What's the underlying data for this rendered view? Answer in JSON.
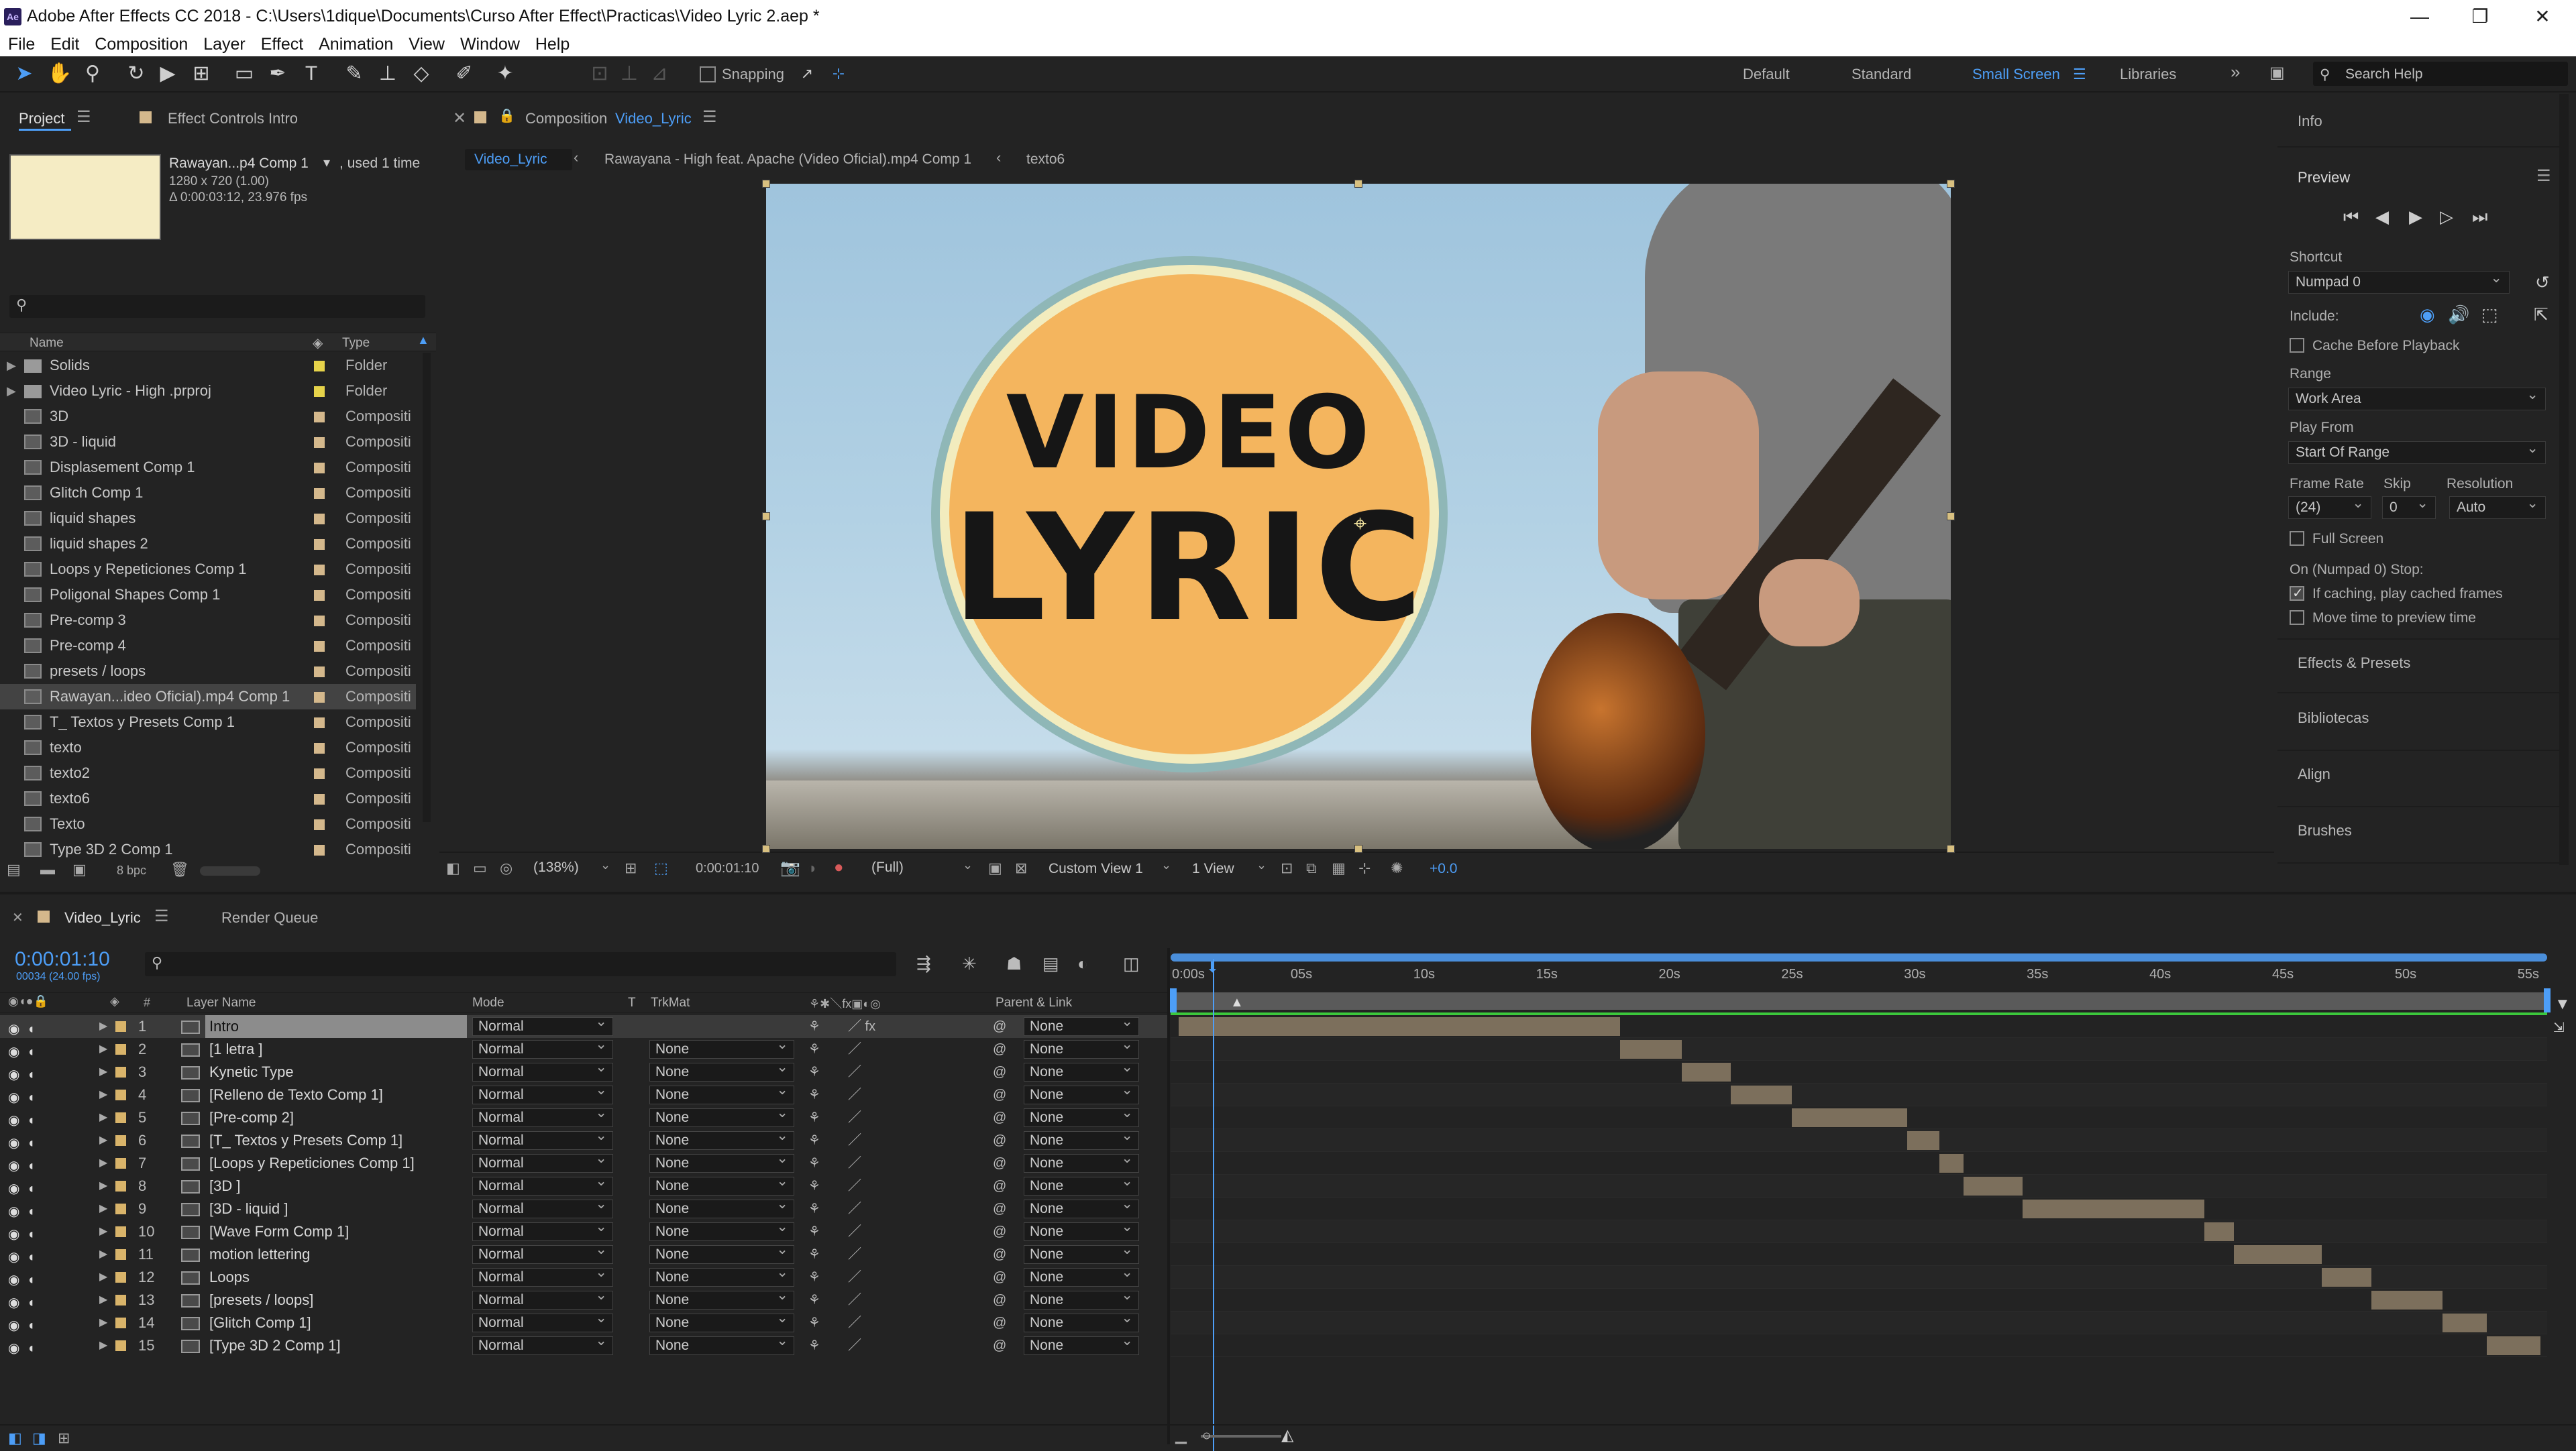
{
  "window": {
    "title": "Adobe After Effects CC 2018 - C:\\Users\\1dique\\Documents\\Curso After Effect\\Practicas\\Video Lyric 2.aep *",
    "app_badge": "Ae"
  },
  "menu": [
    "File",
    "Edit",
    "Composition",
    "Layer",
    "Effect",
    "Animation",
    "View",
    "Window",
    "Help"
  ],
  "toolbar": {
    "snapping_label": "Snapping",
    "workspaces": [
      "Default",
      "Standard",
      "Small Screen",
      "Libraries"
    ],
    "active_workspace": "Small Screen",
    "search_placeholder": "Search Help"
  },
  "project": {
    "tab_project": "Project",
    "tab_effect_controls": "Effect Controls Intro",
    "preview_name": "Rawayan...p4 Comp 1",
    "used": ", used 1 time",
    "dimensions": "1280 x 720 (1.00)",
    "duration": "Δ 0:00:03:12, 23.976 fps",
    "col_name": "Name",
    "col_type": "Type",
    "bpc": "8 bpc",
    "items": [
      {
        "name": "Solids",
        "type": "Folder",
        "kind": "folder",
        "label_color": "#e6d34a"
      },
      {
        "name": "Video Lyric - High .prproj",
        "type": "Folder",
        "kind": "folder",
        "label_color": "#e6d34a"
      },
      {
        "name": "3D",
        "type": "Compositi",
        "kind": "comp",
        "label_color": "#d4b88c"
      },
      {
        "name": "3D - liquid",
        "type": "Compositi",
        "kind": "comp",
        "label_color": "#d4b88c"
      },
      {
        "name": "Displasement Comp 1",
        "type": "Compositi",
        "kind": "comp",
        "label_color": "#d4b88c"
      },
      {
        "name": "Glitch Comp 1",
        "type": "Compositi",
        "kind": "comp",
        "label_color": "#d4b88c"
      },
      {
        "name": "liquid shapes",
        "type": "Compositi",
        "kind": "comp",
        "label_color": "#d4b88c"
      },
      {
        "name": "liquid shapes 2",
        "type": "Compositi",
        "kind": "comp",
        "label_color": "#d4b88c"
      },
      {
        "name": "Loops y Repeticiones Comp 1",
        "type": "Compositi",
        "kind": "comp",
        "label_color": "#d4b88c"
      },
      {
        "name": "Poligonal Shapes Comp 1",
        "type": "Compositi",
        "kind": "comp",
        "label_color": "#d4b88c"
      },
      {
        "name": "Pre-comp 3",
        "type": "Compositi",
        "kind": "comp",
        "label_color": "#d4b88c"
      },
      {
        "name": "Pre-comp 4",
        "type": "Compositi",
        "kind": "comp",
        "label_color": "#d4b88c"
      },
      {
        "name": "presets / loops",
        "type": "Compositi",
        "kind": "comp",
        "label_color": "#d4b88c"
      },
      {
        "name": "Rawayan...ideo Oficial).mp4 Comp 1",
        "type": "Compositi",
        "kind": "comp",
        "label_color": "#d4b88c",
        "selected": true
      },
      {
        "name": "T_ Textos y Presets Comp 1",
        "type": "Compositi",
        "kind": "comp",
        "label_color": "#d4b88c"
      },
      {
        "name": "texto",
        "type": "Compositi",
        "kind": "comp",
        "label_color": "#d4b88c"
      },
      {
        "name": "texto2",
        "type": "Compositi",
        "kind": "comp",
        "label_color": "#d4b88c"
      },
      {
        "name": "texto6",
        "type": "Compositi",
        "kind": "comp",
        "label_color": "#d4b88c"
      },
      {
        "name": "Texto",
        "type": "Compositi",
        "kind": "comp",
        "label_color": "#d4b88c"
      },
      {
        "name": "Type 3D 2 Comp 1",
        "type": "Compositi",
        "kind": "comp",
        "label_color": "#d4b88c"
      }
    ]
  },
  "viewer": {
    "panel_label": "Composition",
    "comp_name": "Video_Lyric",
    "breadcrumbs": [
      "Video_Lyric",
      "Rawayana - High feat. Apache (Video Oficial).mp4 Comp 1",
      "texto6"
    ],
    "logo_line1": "VIDEO",
    "logo_line2": "LYRIC",
    "zoom": "(138%)",
    "timecode": "0:00:01:10",
    "resolution": "(Full)",
    "view": "Custom View 1",
    "views_count": "1 View",
    "exposure": "+0.0"
  },
  "right": {
    "info": "Info",
    "preview": "Preview",
    "shortcut_label": "Shortcut",
    "shortcut": "Numpad 0",
    "include_label": "Include:",
    "cache_before": "Cache Before Playback",
    "range_label": "Range",
    "range": "Work Area",
    "play_from_label": "Play From",
    "play_from": "Start Of Range",
    "frame_rate_label": "Frame Rate",
    "skip_label": "Skip",
    "resolution_label": "Resolution",
    "frame_rate": "(24)",
    "skip": "0",
    "resolution": "Auto",
    "full_screen": "Full Screen",
    "on_stop": "On (Numpad 0) Stop:",
    "if_caching": "If caching, play cached frames",
    "move_time": "Move time to preview time",
    "panels": [
      "Effects & Presets",
      "Bibliotecas",
      "Align",
      "Brushes"
    ]
  },
  "timeline": {
    "tab": "Video_Lyric",
    "render_queue": "Render Queue",
    "timecode": "0:00:01:10",
    "frame_info": "00034 (24.00 fps)",
    "cols": {
      "layer_name": "Layer Name",
      "mode": "Mode",
      "t": "T",
      "trkmat": "TrkMat",
      "parent": "Parent & Link"
    },
    "ruler": [
      "0:00s",
      "05s",
      "10s",
      "15s",
      "20s",
      "25s",
      "30s",
      "35s",
      "40s",
      "45s",
      "50s",
      "55s"
    ],
    "layers": [
      {
        "num": "1",
        "name": "Intro",
        "mode": "Normal",
        "trkmat": "",
        "parent": "None",
        "start": 0.0,
        "end": 18.0
      },
      {
        "num": "2",
        "name": "[1 letra ]",
        "mode": "Normal",
        "trkmat": "None",
        "parent": "None",
        "start": 18.0,
        "end": 20.5
      },
      {
        "num": "3",
        "name": "Kynetic Type",
        "mode": "Normal",
        "trkmat": "None",
        "parent": "None",
        "start": 20.5,
        "end": 22.5
      },
      {
        "num": "4",
        "name": "[Relleno de Texto Comp 1]",
        "mode": "Normal",
        "trkmat": "None",
        "parent": "None",
        "start": 22.5,
        "end": 25.0
      },
      {
        "num": "5",
        "name": "[Pre-comp 2]",
        "mode": "Normal",
        "trkmat": "None",
        "parent": "None",
        "start": 25.0,
        "end": 29.7
      },
      {
        "num": "6",
        "name": "[T_ Textos y Presets Comp 1]",
        "mode": "Normal",
        "trkmat": "None",
        "parent": "None",
        "start": 29.7,
        "end": 31.0
      },
      {
        "num": "7",
        "name": "[Loops y Repeticiones Comp 1]",
        "mode": "Normal",
        "trkmat": "None",
        "parent": "None",
        "start": 31.0,
        "end": 32.0
      },
      {
        "num": "8",
        "name": "[3D ]",
        "mode": "Normal",
        "trkmat": "None",
        "parent": "None",
        "start": 32.0,
        "end": 34.4
      },
      {
        "num": "9",
        "name": "[3D - liquid ]",
        "mode": "Normal",
        "trkmat": "None",
        "parent": "None",
        "start": 34.4,
        "end": 41.8
      },
      {
        "num": "10",
        "name": "[Wave Form Comp 1]",
        "mode": "Normal",
        "trkmat": "None",
        "parent": "None",
        "start": 41.8,
        "end": 43.0
      },
      {
        "num": "11",
        "name": "motion lettering",
        "mode": "Normal",
        "trkmat": "None",
        "parent": "None",
        "start": 43.0,
        "end": 46.6
      },
      {
        "num": "12",
        "name": "Loops",
        "mode": "Normal",
        "trkmat": "None",
        "parent": "None",
        "start": 46.6,
        "end": 48.6
      },
      {
        "num": "13",
        "name": "[presets / loops]",
        "mode": "Normal",
        "trkmat": "None",
        "parent": "None",
        "start": 48.6,
        "end": 51.5
      },
      {
        "num": "14",
        "name": "[Glitch Comp 1]",
        "mode": "Normal",
        "trkmat": "None",
        "parent": "None",
        "start": 51.5,
        "end": 53.3
      },
      {
        "num": "15",
        "name": "[Type 3D 2  Comp 1]",
        "mode": "Normal",
        "trkmat": "None",
        "parent": "None",
        "start": 53.3,
        "end": 55.5
      }
    ],
    "playhead_seconds": 1.4,
    "colors": {
      "bar": "#7c6f5c",
      "playhead": "#4d9ef7",
      "accent": "#4d9ef7"
    }
  }
}
